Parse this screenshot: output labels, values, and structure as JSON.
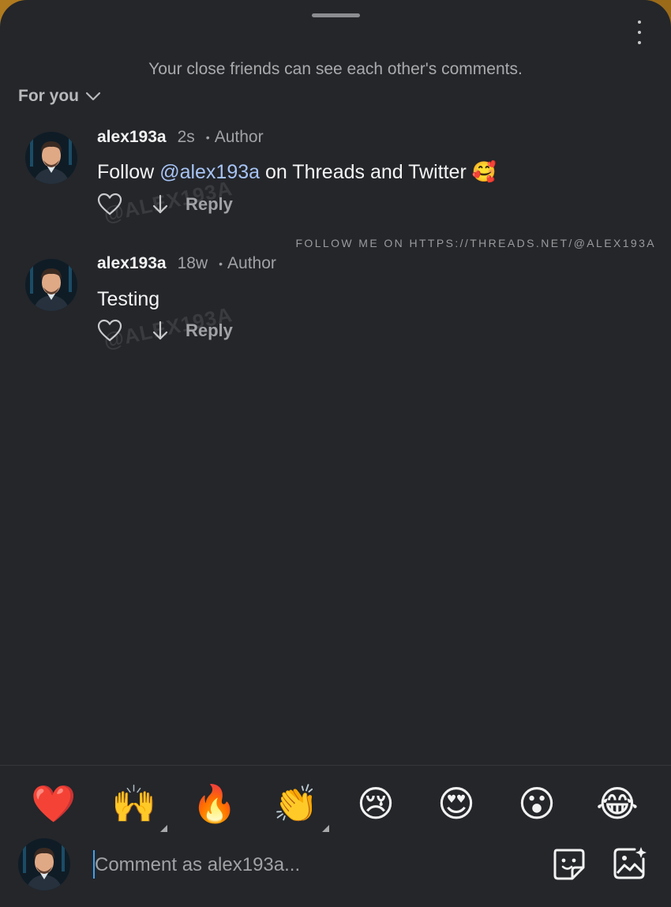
{
  "notice": "Your close friends can see each other's comments.",
  "sort": {
    "label": "For you"
  },
  "follow_banner": "FOLLOW ME ON HTTPS://THREADS.NET/@ALEX193A",
  "watermark": "@ALEX193A",
  "comments": [
    {
      "username": "alex193a",
      "time": "2s",
      "role": "Author",
      "body_prefix": "Follow ",
      "mention": "@alex193a",
      "body_suffix": " on Threads and Twitter 🥰",
      "reply_label": "Reply"
    },
    {
      "username": "alex193a",
      "time": "18w",
      "role": "Author",
      "body": "Testing",
      "reply_label": "Reply"
    }
  ],
  "reactions": [
    "❤️",
    "🙌",
    "🔥",
    "👏",
    "😢",
    "😍",
    "😮",
    "😂"
  ],
  "composer": {
    "placeholder": "Comment as alex193a..."
  },
  "colors": {
    "background": "#24262a",
    "mention": "#a7c3f5",
    "caret": "#3ea0f0"
  }
}
